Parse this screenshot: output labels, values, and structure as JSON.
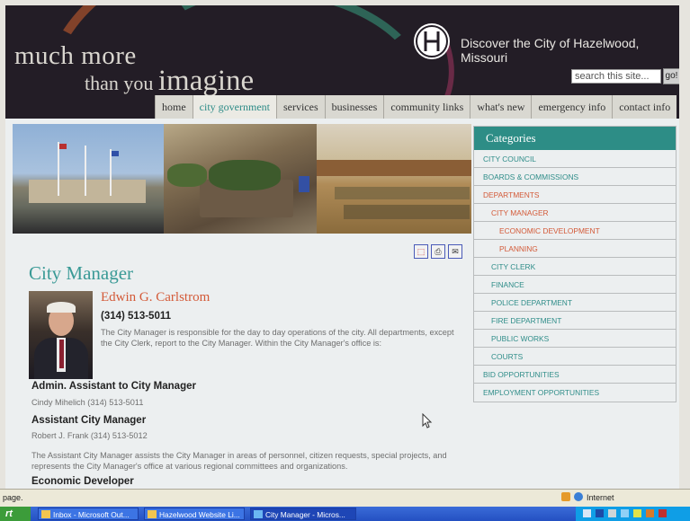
{
  "header": {
    "tagline_line1": "much more",
    "tagline_line2_prefix": "than you",
    "tagline_line2_big": "imagine",
    "discover_text": "Discover the City of Hazelwood, Missouri",
    "search_placeholder": "search this site...",
    "go_label": "go!"
  },
  "nav": {
    "items": [
      "home",
      "city government",
      "services",
      "businesses",
      "community links",
      "what's new",
      "emergency info",
      "contact info"
    ],
    "active": "city government"
  },
  "content": {
    "page_title": "City Manager",
    "manager_name": "Edwin G. Carlstrom",
    "manager_phone": "(314) 513-5011",
    "manager_desc": "The City Manager is responsible for the day to day operations of the city. All departments, except the City Clerk, report to the City Manager. Within the City Manager's office is:",
    "admin_assistant_title": "Admin. Assistant to City Manager",
    "admin_assistant_contact": "Cindy Mihelich (314) 513-5011",
    "assistant_title": "Assistant City Manager",
    "assistant_contact": "Robert J. Frank (314) 513-5012",
    "assistant_desc": "The Assistant City Manager assists the City Manager in areas of personnel, citizen requests, special projects, and represents the City Manager's office at various regional committees and organizations.",
    "econ_dev_title": "Economic Developer"
  },
  "categories": {
    "heading": "Categories",
    "items": [
      {
        "label": "CITY COUNCIL",
        "indent": 0,
        "highlight": false
      },
      {
        "label": "BOARDS & COMMISSIONS",
        "indent": 0,
        "highlight": false
      },
      {
        "label": "DEPARTMENTS",
        "indent": 0,
        "highlight": true
      },
      {
        "label": "CITY MANAGER",
        "indent": 1,
        "highlight": true
      },
      {
        "label": "ECONOMIC DEVELOPMENT",
        "indent": 2,
        "highlight": true
      },
      {
        "label": "PLANNING",
        "indent": 2,
        "highlight": true
      },
      {
        "label": "CITY CLERK",
        "indent": 1,
        "highlight": false
      },
      {
        "label": "FINANCE",
        "indent": 1,
        "highlight": false
      },
      {
        "label": "POLICE DEPARTMENT",
        "indent": 1,
        "highlight": false
      },
      {
        "label": "FIRE DEPARTMENT",
        "indent": 1,
        "highlight": false
      },
      {
        "label": "PUBLIC WORKS",
        "indent": 1,
        "highlight": false
      },
      {
        "label": "COURTS",
        "indent": 1,
        "highlight": false
      },
      {
        "label": "BID OPPORTUNITIES",
        "indent": 0,
        "highlight": false
      },
      {
        "label": "EMPLOYMENT OPPORTUNITIES",
        "indent": 0,
        "highlight": false
      }
    ]
  },
  "doc_icons": [
    "pdf-icon",
    "print-icon",
    "email-icon"
  ],
  "statusbar": {
    "left_text": "page.",
    "zone_text": "Internet"
  },
  "taskbar": {
    "start_label": "rt",
    "tasks": [
      {
        "label": "Inbox - Microsoft Out...",
        "active": false
      },
      {
        "label": "Hazelwood Website Li...",
        "active": false
      },
      {
        "label": "City Manager - Micros...",
        "active": true
      }
    ]
  },
  "colors": {
    "header_bg": "#231d26",
    "accent_teal": "#2d8d86",
    "accent_orange": "#d35a38",
    "nav_bg": "#d9d8d1"
  }
}
